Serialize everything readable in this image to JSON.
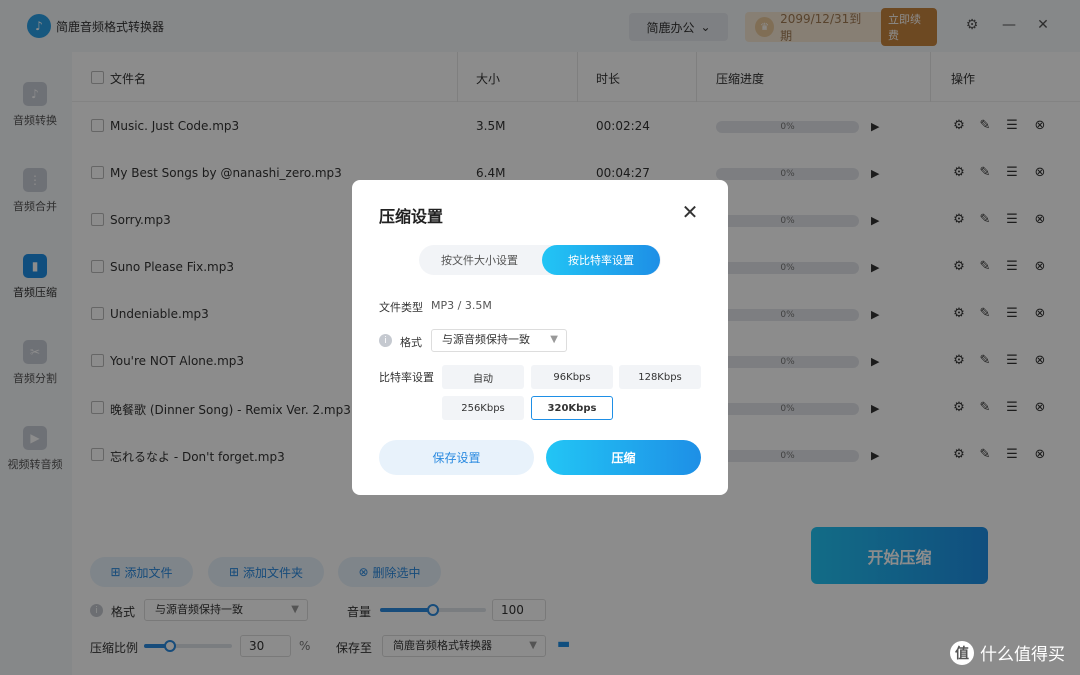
{
  "app": {
    "title": "简鹿音频格式转换器",
    "account": "简鹿办公",
    "expiry": "2099/12/31到期",
    "renew": "立即续费"
  },
  "sidebar": [
    {
      "label": "音频转换"
    },
    {
      "label": "音频合并"
    },
    {
      "label": "音频压缩"
    },
    {
      "label": "音频分割"
    },
    {
      "label": "视频转音频"
    }
  ],
  "table": {
    "headers": {
      "name": "文件名",
      "size": "大小",
      "duration": "时长",
      "progress": "压缩进度",
      "ops": "操作"
    },
    "rows": [
      {
        "name": "Music. Just Code.mp3",
        "size": "3.5M",
        "duration": "00:02:24",
        "progress": "0%"
      },
      {
        "name": "My Best Songs by @nanashi_zero.mp3",
        "size": "6.4M",
        "duration": "00:04:27",
        "progress": "0%"
      },
      {
        "name": "Sorry.mp3",
        "size": "",
        "duration": "",
        "progress": "0%"
      },
      {
        "name": "Suno Please Fix.mp3",
        "size": "",
        "duration": "",
        "progress": "0%"
      },
      {
        "name": "Undeniable.mp3",
        "size": "",
        "duration": "",
        "progress": "0%"
      },
      {
        "name": "You're NOT Alone.mp3",
        "size": "",
        "duration": "",
        "progress": "0%"
      },
      {
        "name": "晚餐歌 (Dinner Song) - Remix Ver. 2.mp3",
        "size": "",
        "duration": "",
        "progress": "0%"
      },
      {
        "name": "忘れるなよ - Don't forget.mp3",
        "size": "",
        "duration": "",
        "progress": "0%"
      }
    ]
  },
  "actions": {
    "add_file": "添加文件",
    "add_folder": "添加文件夹",
    "delete_selected": "删除选中"
  },
  "settings": {
    "format_label": "格式",
    "format_value": "与源音频保持一致",
    "volume_label": "音量",
    "volume_value": "100",
    "volume_level": 0.5,
    "ratio_label": "压缩比例",
    "ratio_value": "30",
    "ratio_unit": "%",
    "ratio_level": 0.3,
    "save_label": "保存至",
    "save_value": "简鹿音频格式转换器"
  },
  "start_button": "开始压缩",
  "dialog": {
    "title": "压缩设置",
    "tabs": [
      "按文件大小设置",
      "按比特率设置"
    ],
    "active_tab": 1,
    "file_type_label": "文件类型",
    "file_type_value": "MP3 / 3.5M",
    "format_label": "格式",
    "format_value": "与源音频保持一致",
    "bitrate_label": "比特率设置",
    "bitrates": [
      "自动",
      "96Kbps",
      "128Kbps",
      "256Kbps",
      "320Kbps"
    ],
    "selected_bitrate": "320Kbps",
    "save_button": "保存设置",
    "compress_button": "压缩"
  },
  "watermark": "什么值得买"
}
